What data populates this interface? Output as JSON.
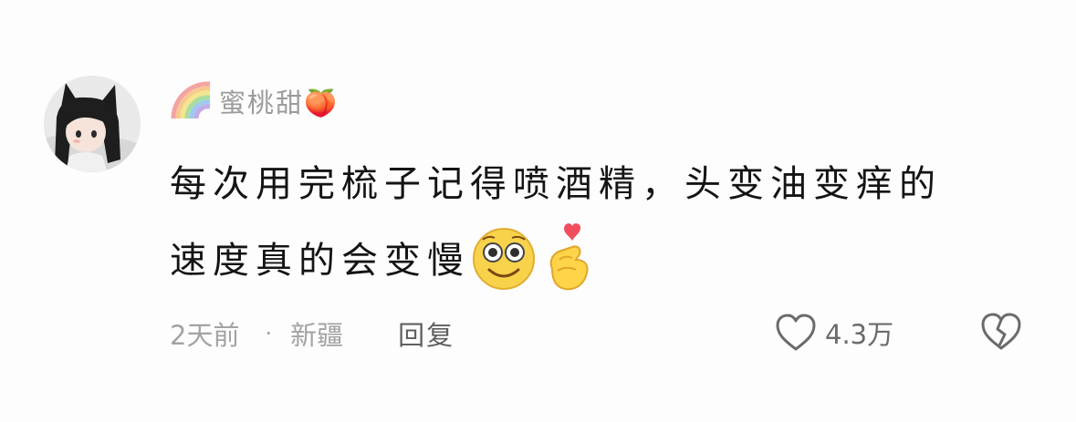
{
  "comment": {
    "username": "蜜桃甜🍑",
    "content_line1": "每次用完梳子记得喷酒精，头变油变痒的",
    "content_line2": "速度真的会变慢",
    "content_emojis": [
      "smile-emoji",
      "finger-heart-emoji"
    ],
    "time": "2天前",
    "separator": "·",
    "location": "新疆",
    "reply_label": "回复",
    "like_count": "4.3万"
  },
  "icons": {
    "avatar": "anime-cat-girl-avatar",
    "username_badge": "rainbow-icon",
    "like": "heart-outline-icon",
    "dislike": "broken-heart-outline-icon"
  },
  "colors": {
    "username": "#9c9c9c",
    "text": "#141414",
    "meta": "#a3a3a3",
    "reply": "#5f5f5f",
    "icon": "#6b6b6b"
  }
}
